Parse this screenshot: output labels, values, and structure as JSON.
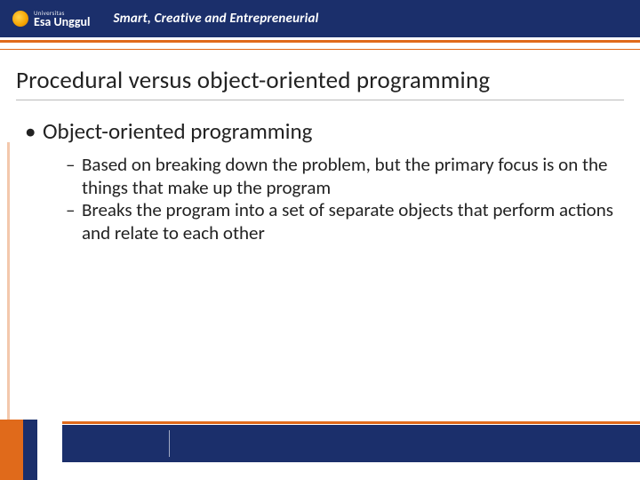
{
  "header": {
    "logo_univ": "Universitas",
    "logo_name": "Esa Unggul",
    "tagline": "Smart, Creative and Entrepreneurial"
  },
  "title": "Procedural versus object-oriented programming",
  "bullets": {
    "lvl1": "Object-oriented programming",
    "lvl2": [
      "Based on breaking down the problem, but the primary focus is on the things that make up the program",
      "Breaks the program into a set of separate objects that perform actions and relate to each other"
    ]
  }
}
